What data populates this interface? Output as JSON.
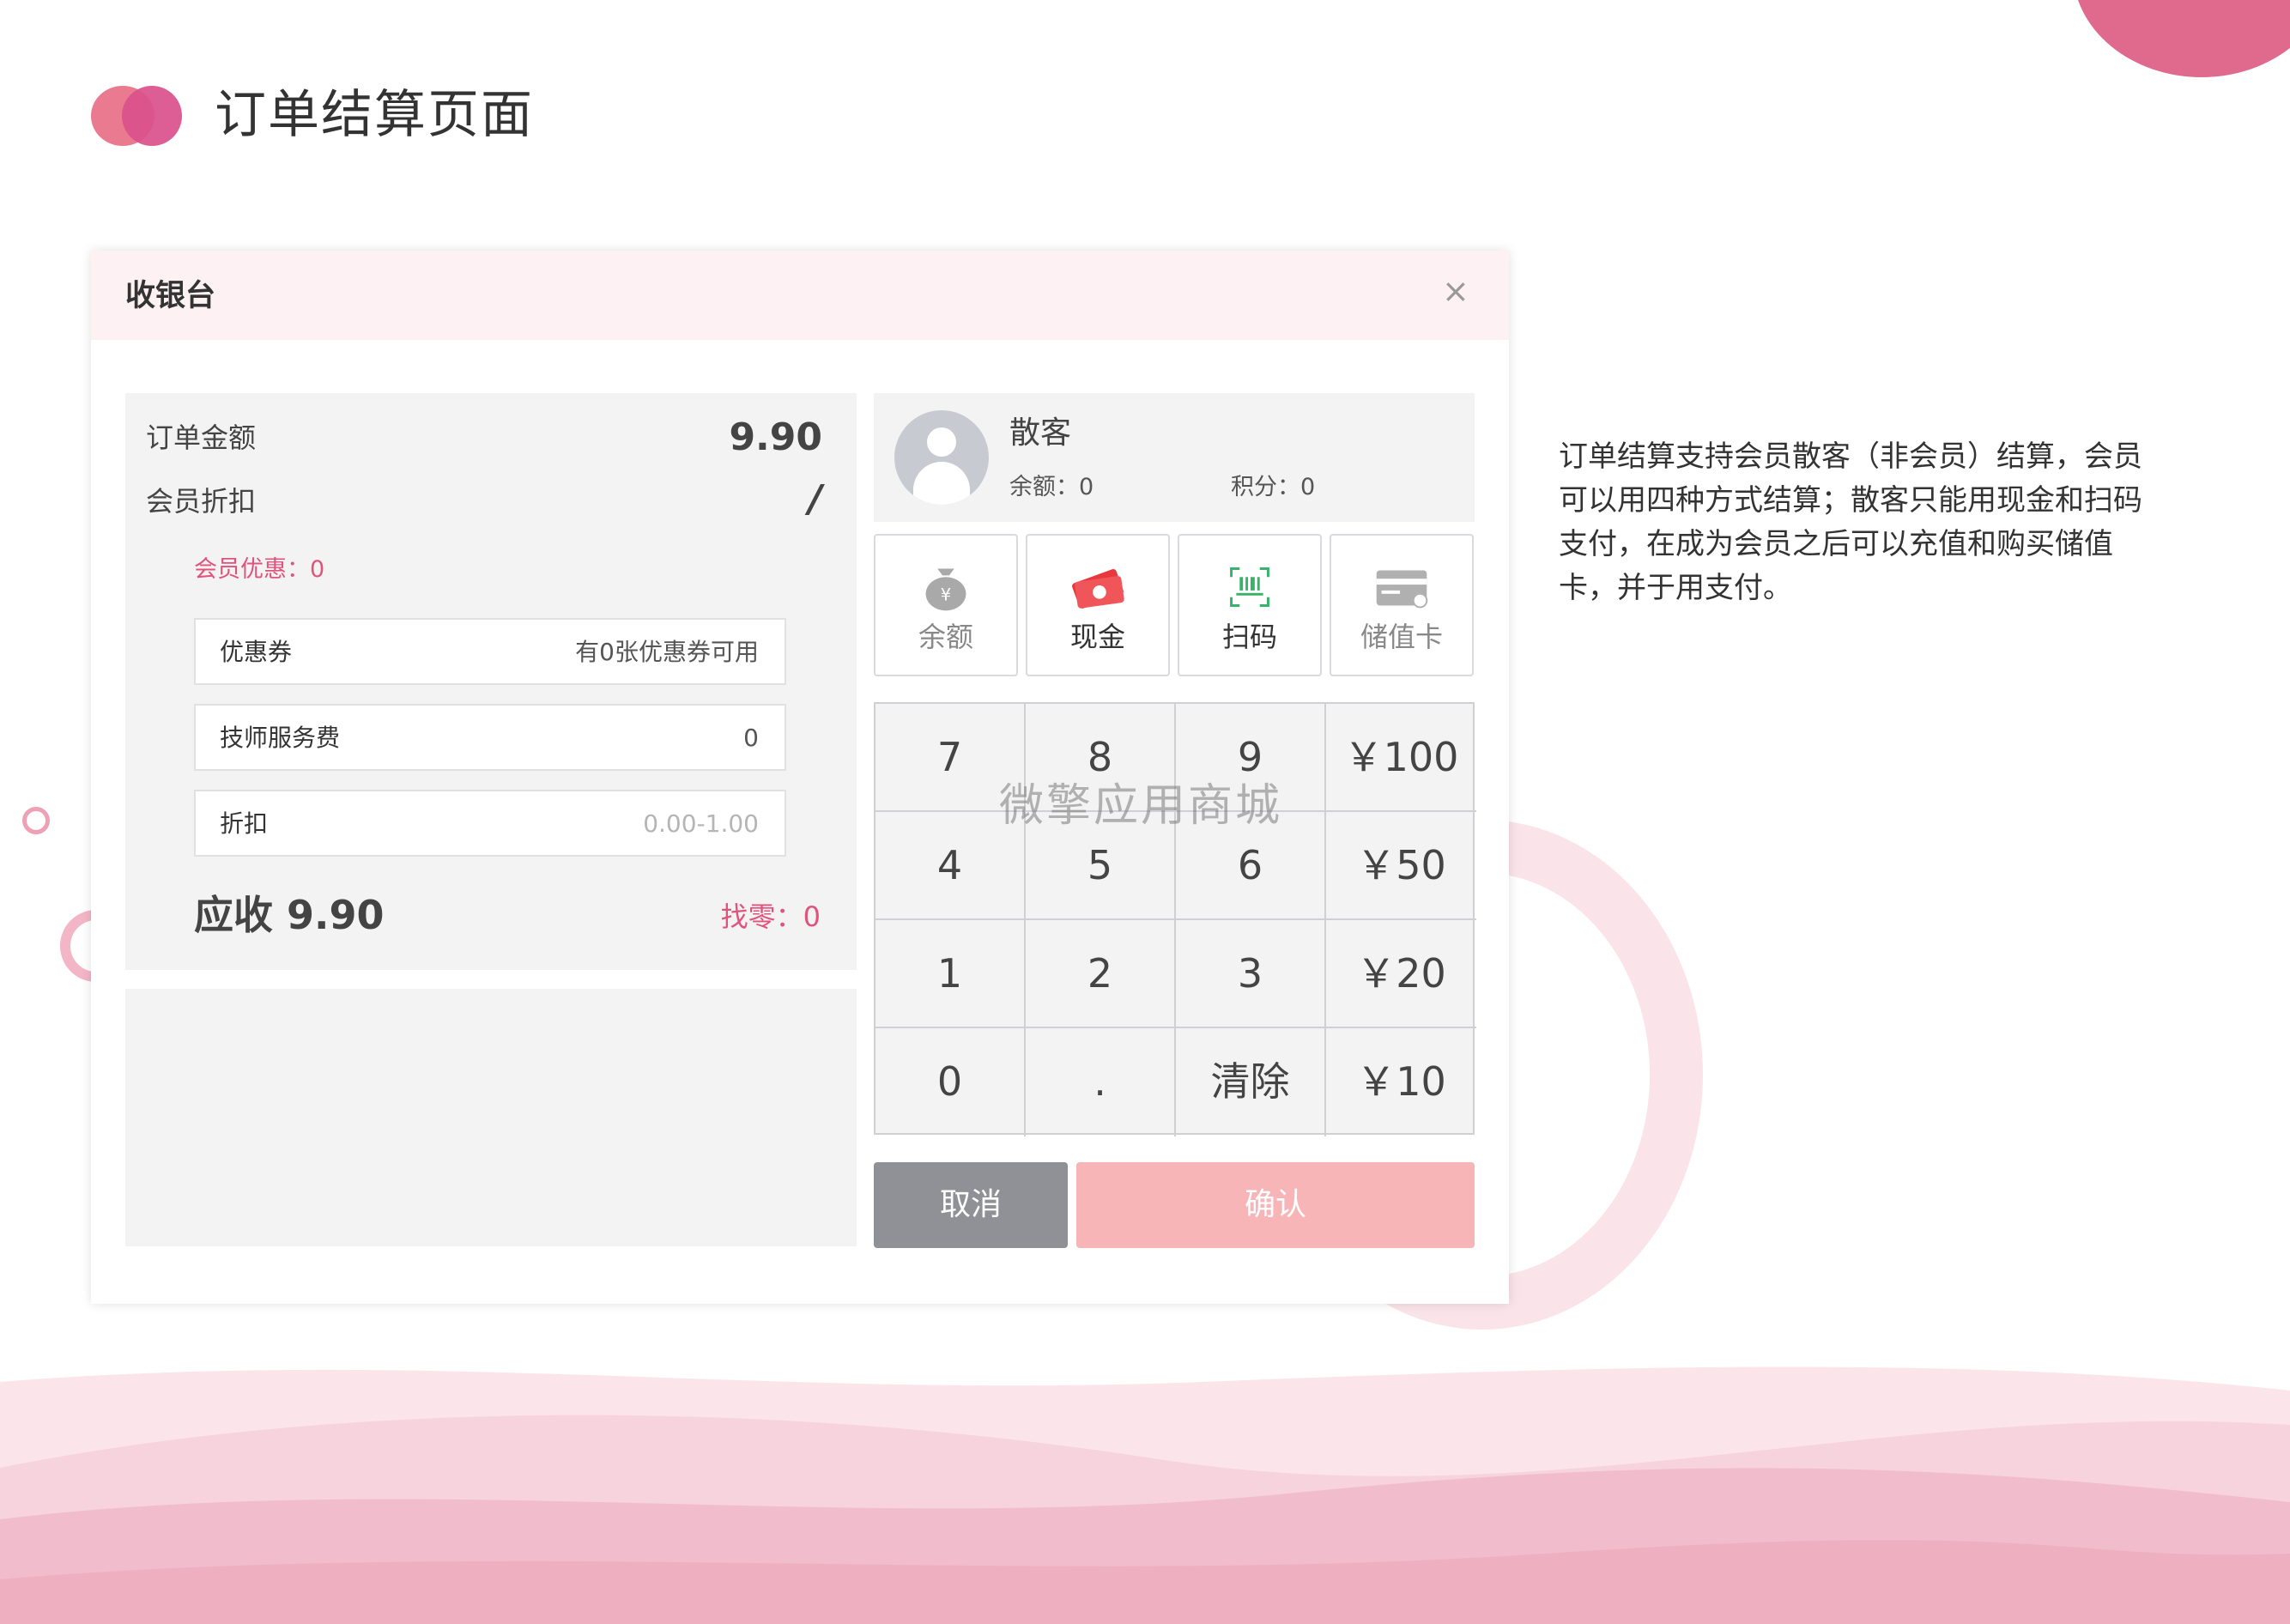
{
  "page": {
    "title": "订单结算页面",
    "description": "订单结算支持会员散客（非会员）结算，会员可以用四种方式结算；散客只能用现金和扫码支付，在成为会员之后可以充值和购买储值卡，并于用支付。"
  },
  "dialog": {
    "title": "收银台",
    "close_label": "×",
    "order": {
      "amount_label": "订单金额",
      "amount_value": "9.90",
      "discount_label": "会员折扣",
      "discount_value": "/",
      "member_promo": "会员优惠：0"
    },
    "fields": {
      "coupon": {
        "label": "优惠券",
        "value": "有0张优惠券可用"
      },
      "tech_fee": {
        "label": "技师服务费",
        "value": "0"
      },
      "discount": {
        "label": "折扣",
        "placeholder": "0.00-1.00"
      }
    },
    "receivable": "应收 9.90",
    "change": "找零：0",
    "member": {
      "name": "散客",
      "balance": "余额：0",
      "points": "积分：0"
    },
    "pay_methods": [
      {
        "label": "余额",
        "icon": "money-bag-icon"
      },
      {
        "label": "现金",
        "icon": "cash-icon"
      },
      {
        "label": "扫码",
        "icon": "scan-code-icon"
      },
      {
        "label": "储值卡",
        "icon": "stored-value-card-icon"
      }
    ],
    "keypad": [
      [
        "7",
        "8",
        "9",
        "￥100"
      ],
      [
        "4",
        "5",
        "6",
        "￥50"
      ],
      [
        "1",
        "2",
        "3",
        "￥20"
      ],
      [
        "0",
        ".",
        "清除",
        "￥10"
      ]
    ],
    "cancel_label": "取消",
    "confirm_label": "确认"
  },
  "watermark": "微擎应用商城",
  "colors": {
    "accent": "#e0537d",
    "header_bg": "#fdf1f4",
    "panel_bg": "#f3f3f4",
    "confirm_bg": "#f8b5b7",
    "cancel_bg": "#8f9196"
  }
}
